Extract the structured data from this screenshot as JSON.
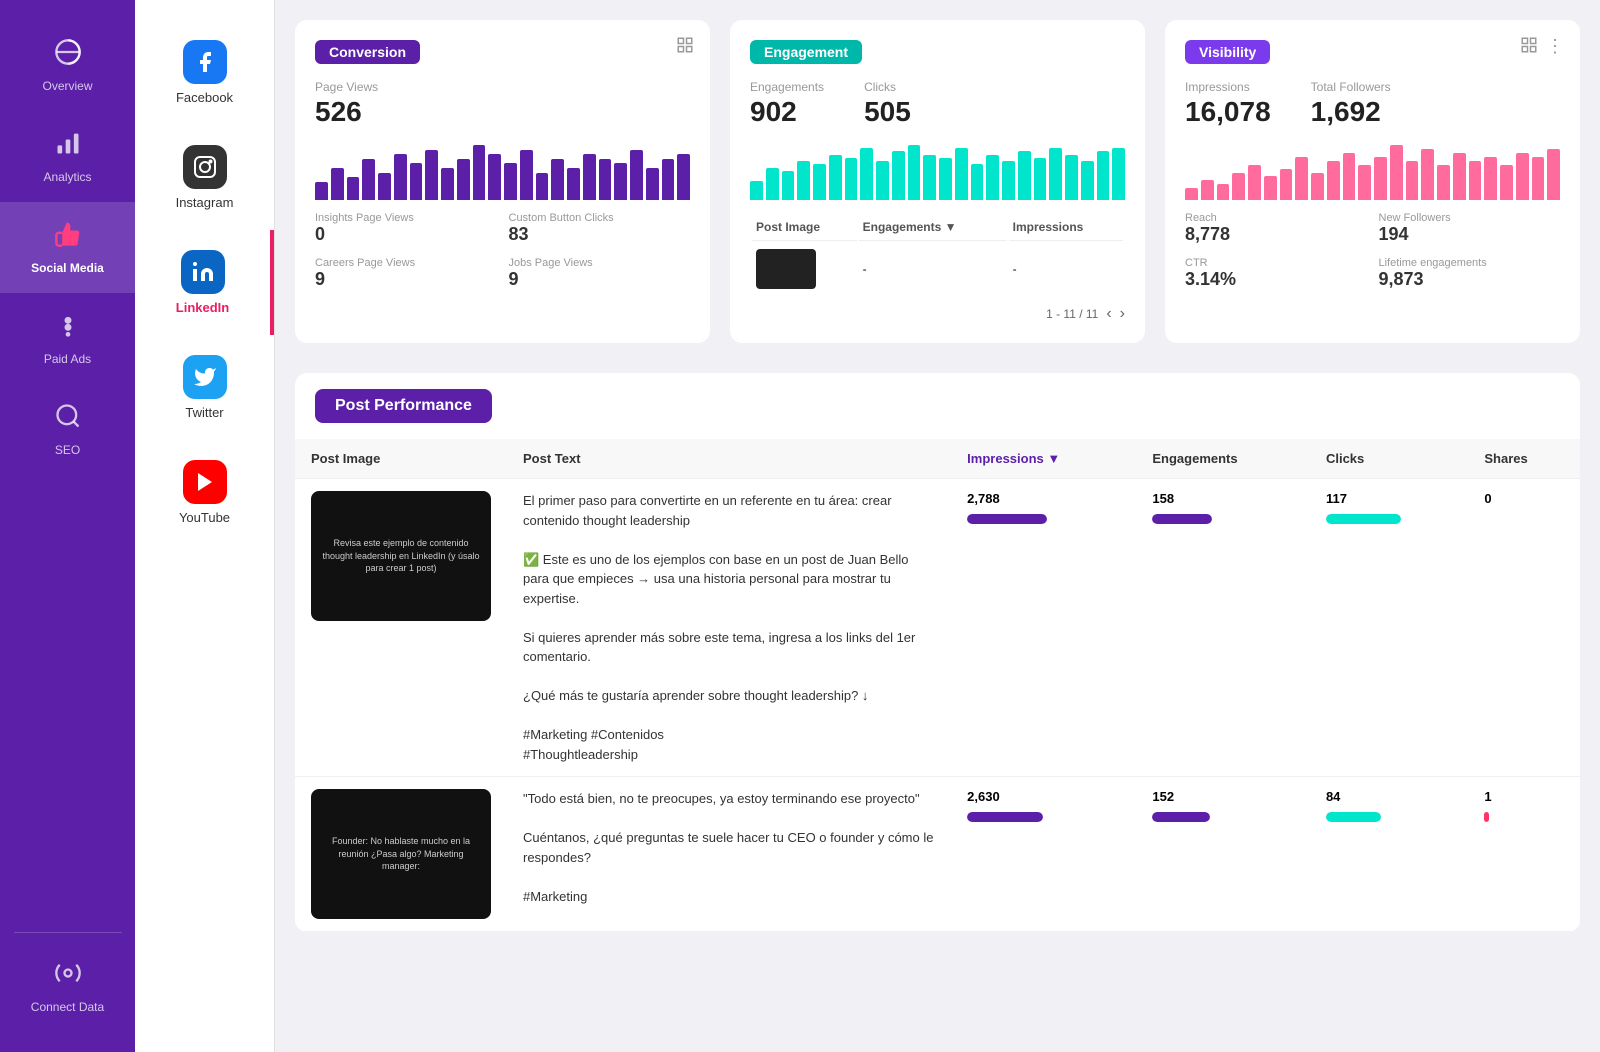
{
  "leftNav": {
    "items": [
      {
        "id": "overview",
        "label": "Overview",
        "icon": "📊",
        "active": false
      },
      {
        "id": "analytics",
        "label": "Analytics",
        "icon": "📈",
        "active": false
      },
      {
        "id": "social-media",
        "label": "Social Media",
        "icon": "👍",
        "active": true
      },
      {
        "id": "paid-ads",
        "label": "Paid Ads",
        "icon": "💰",
        "active": false
      },
      {
        "id": "seo",
        "label": "SEO",
        "icon": "🔍",
        "active": false
      },
      {
        "id": "connect-data",
        "label": "Connect Data",
        "icon": "⚙",
        "active": false
      }
    ]
  },
  "secondNav": {
    "items": [
      {
        "id": "facebook",
        "label": "Facebook",
        "icon": "f",
        "type": "fb",
        "active": false
      },
      {
        "id": "instagram",
        "label": "Instagram",
        "icon": "◎",
        "type": "ig",
        "active": false
      },
      {
        "id": "linkedin",
        "label": "LinkedIn",
        "icon": "in",
        "type": "li",
        "active": true
      },
      {
        "id": "twitter",
        "label": "Twitter",
        "icon": "🐦",
        "type": "tw",
        "active": false
      },
      {
        "id": "youtube",
        "label": "YouTube",
        "icon": "▶",
        "type": "yt",
        "active": false
      }
    ]
  },
  "conversionCard": {
    "badge": "Conversion",
    "pageViews": {
      "label": "Page Views",
      "value": "526"
    },
    "chartBars": [
      20,
      35,
      25,
      45,
      30,
      50,
      40,
      55,
      35,
      45,
      60,
      50,
      40,
      55,
      30,
      45,
      35,
      50,
      45,
      40,
      55,
      35,
      45,
      50
    ],
    "insightsPageViews": {
      "label": "Insights Page Views",
      "value": "0"
    },
    "customButtonClicks": {
      "label": "Custom Button Clicks",
      "value": "83"
    },
    "careersPageViews": {
      "label": "Careers Page Views",
      "value": "9"
    },
    "jobsPageViews": {
      "label": "Jobs Page Views",
      "value": "9"
    }
  },
  "engagementCard": {
    "badge": "Engagement",
    "engagements": {
      "label": "Engagements",
      "value": "902"
    },
    "clicks": {
      "label": "Clicks",
      "value": "505"
    },
    "chartBars": [
      30,
      50,
      45,
      60,
      55,
      70,
      65,
      80,
      60,
      75,
      85,
      70,
      65,
      80,
      55,
      70,
      60,
      75,
      65,
      80,
      70,
      60,
      75,
      80
    ],
    "tableHeaders": [
      "Post Image",
      "Engagements ▼",
      "Impressions"
    ],
    "pagination": "1 - 11 / 11"
  },
  "visibilityCard": {
    "badge": "Visibility",
    "impressions": {
      "label": "Impressions",
      "value": "16,078"
    },
    "totalFollowers": {
      "label": "Total Followers",
      "value": "1,692"
    },
    "chartBars": [
      15,
      25,
      20,
      35,
      45,
      30,
      40,
      55,
      35,
      50,
      60,
      45,
      55,
      70,
      50,
      65,
      45,
      60,
      50,
      55,
      45,
      60,
      55,
      65
    ],
    "reach": {
      "label": "Reach",
      "value": "8,778"
    },
    "newFollowers": {
      "label": "New Followers",
      "value": "194"
    },
    "ctr": {
      "label": "CTR",
      "value": "3.14%"
    },
    "lifetimeEngagements": {
      "label": "Lifetime engagements",
      "value": "9,873"
    }
  },
  "postPerformance": {
    "title": "Post Performance",
    "columns": [
      "Post Image",
      "Post Text",
      "Impressions ▼",
      "Engagements",
      "Clicks",
      "Shares"
    ],
    "rows": [
      {
        "imageText": "Revisa este ejemplo de contenido thought leadership en LinkedIn\n(y úsalo para crear 1 post)",
        "postText": "El primer paso para convertirte en un referente en tu área: crear contenido thought leadership\n\n✅ Este es uno de los ejemplos con base en un post de Juan Bello para que empieces → usa una historia personal para mostrar tu expertise.\n\nSi quieres aprender más sobre este tema, ingresa a los links del 1er comentario.\n\n¿Qué más te gustaría aprender sobre thought leadership? ↓\n\n#Marketing #Contenidos\n#Thoughtleadership",
        "impressions": "2,788",
        "impressionsBarWidth": 80,
        "engagements": "158",
        "engagementsBarWidth": 60,
        "clicks": "117",
        "clicksBarWidth": 75,
        "shares": "0",
        "sharesBarWidth": 0
      },
      {
        "imageText": "Founder:\nNo hablaste mucho en la reunión ¿Pasa algo?\nMarketing manager:",
        "postText": "\"Todo está bien, no te preocupes, ya estoy terminando ese proyecto\"\n\nCuéntanos, ¿qué preguntas te suele hacer tu CEO o founder y cómo le respondes?\n\n#Marketing",
        "impressions": "2,630",
        "impressionsBarWidth": 76,
        "engagements": "152",
        "engagementsBarWidth": 58,
        "clicks": "84",
        "clicksBarWidth": 55,
        "shares": "1",
        "sharesBarWidth": 5
      }
    ]
  }
}
